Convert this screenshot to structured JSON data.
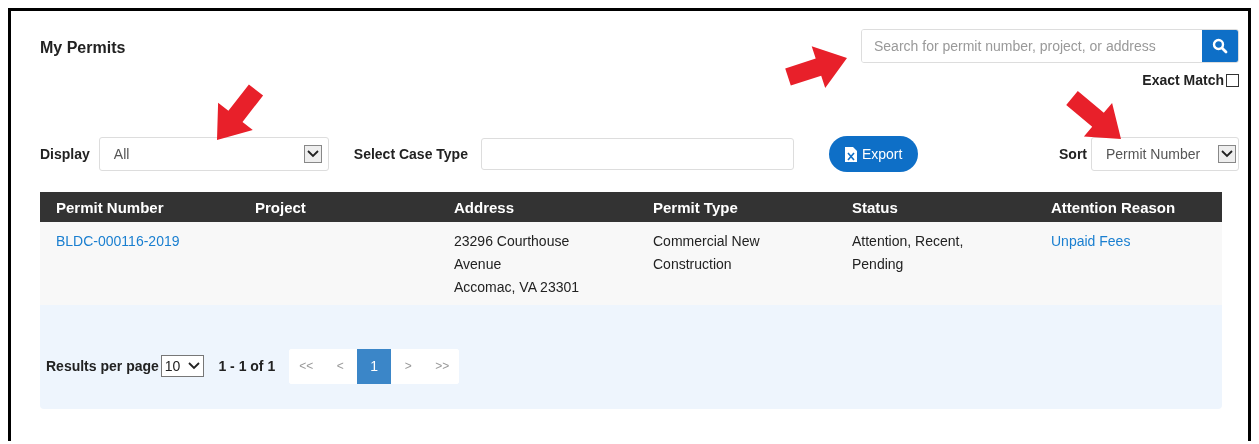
{
  "page": {
    "title": "My Permits"
  },
  "search": {
    "placeholder": "Search for permit number, project, or address"
  },
  "exact_match": {
    "label": "Exact Match",
    "checked": false
  },
  "filters": {
    "display": {
      "label": "Display",
      "value": "All"
    },
    "case_type": {
      "label": "Select Case Type"
    },
    "export_button": "Export",
    "sort": {
      "label": "Sort",
      "value": "Permit Number"
    }
  },
  "table": {
    "columns": [
      "Permit Number",
      "Project",
      "Address",
      "Permit Type",
      "Status",
      "Attention Reason"
    ],
    "rows": [
      {
        "cells": [
          {
            "kind": "link",
            "text": "BLDC-000116-2019"
          },
          {
            "kind": "empty"
          },
          {
            "kind": "text",
            "lines": [
              "23296 Courthouse Avenue",
              "Accomac, VA 23301"
            ]
          },
          {
            "kind": "text",
            "lines": [
              "Commercial New Construction"
            ]
          },
          {
            "kind": "text",
            "lines": [
              "Attention, Recent, Pending"
            ]
          },
          {
            "kind": "link",
            "text": "Unpaid Fees"
          }
        ]
      }
    ]
  },
  "pagination": {
    "per_page_label": "Results per page",
    "per_page": "10",
    "range": "1 - 1 of 1",
    "pages": [
      {
        "label": "<<",
        "selected": false
      },
      {
        "label": "<",
        "selected": false
      },
      {
        "label": "1",
        "selected": true
      },
      {
        "label": ">",
        "selected": false
      },
      {
        "label": ">>",
        "selected": false
      }
    ]
  }
}
